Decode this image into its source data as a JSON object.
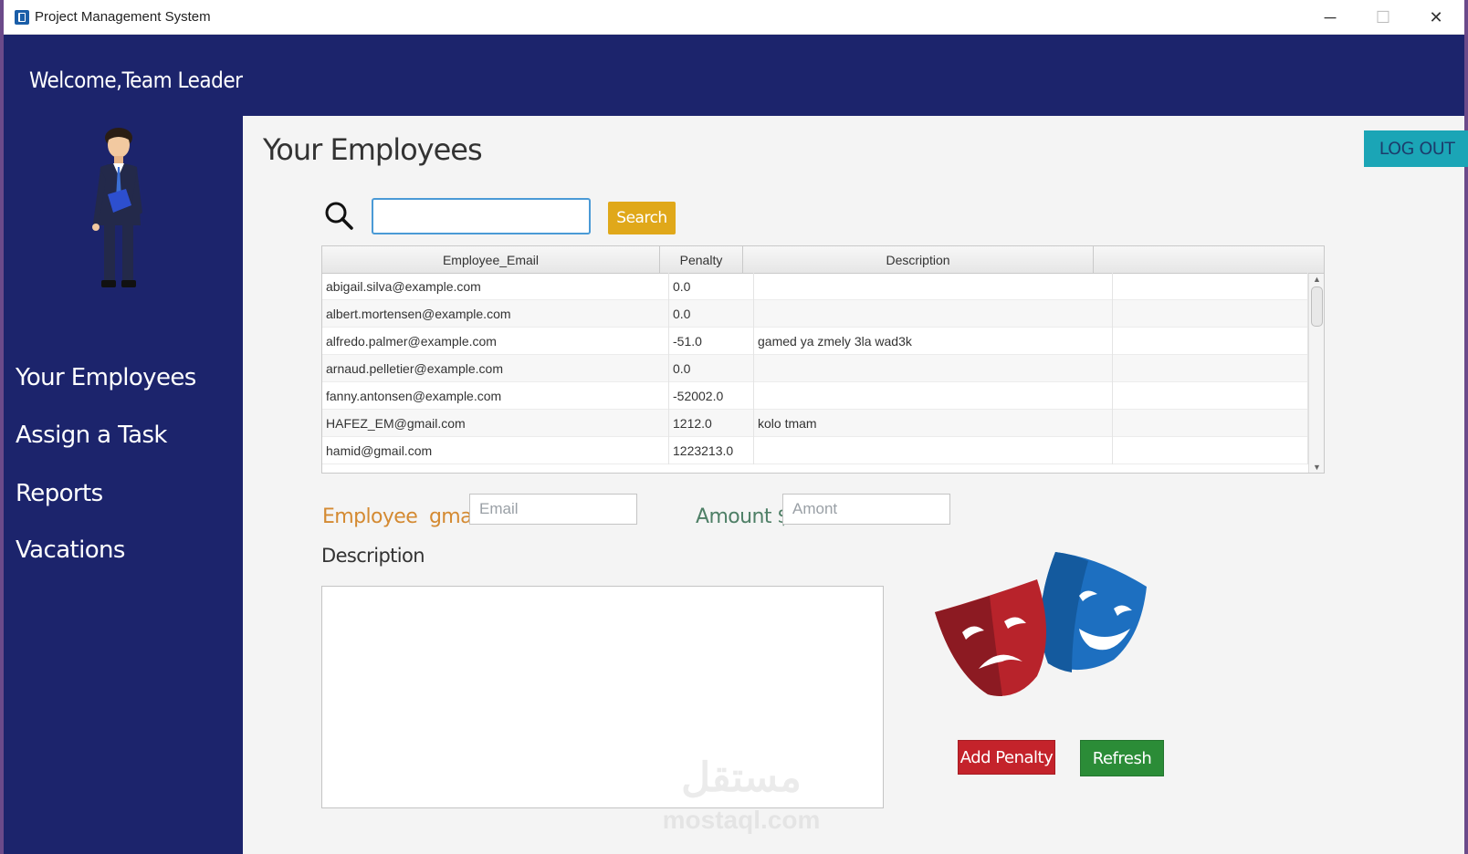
{
  "window": {
    "title": "Project Management System",
    "minimize": "─",
    "maximize": "☐",
    "close": "✕"
  },
  "header": {
    "welcome": "Welcome,Team Leader"
  },
  "sidebar": {
    "items": [
      {
        "label": "Your Employees"
      },
      {
        "label": "Assign a Task"
      },
      {
        "label": "Reports"
      },
      {
        "label": "Vacations"
      }
    ]
  },
  "main": {
    "title": "Your Employees",
    "logout_label": "LOG OUT",
    "search": {
      "value": "",
      "button_label": "Search"
    }
  },
  "table": {
    "columns": [
      "Employee_Email",
      "Penalty",
      "Description",
      ""
    ],
    "rows": [
      {
        "email": "abigail.silva@example.com",
        "penalty": "0.0",
        "description": ""
      },
      {
        "email": "albert.mortensen@example.com",
        "penalty": "0.0",
        "description": ""
      },
      {
        "email": "alfredo.palmer@example.com",
        "penalty": "-51.0",
        "description": "gamed ya zmely 3la wad3k"
      },
      {
        "email": "arnaud.pelletier@example.com",
        "penalty": "0.0",
        "description": ""
      },
      {
        "email": "fanny.antonsen@example.com",
        "penalty": "-52002.0",
        "description": ""
      },
      {
        "email": "HAFEZ_EM@gmail.com",
        "penalty": "1212.0",
        "description": "kolo tmam"
      },
      {
        "email": "hamid@gmail.com",
        "penalty": "1223213.0",
        "description": ""
      }
    ]
  },
  "form": {
    "email_label": "Employee  gmail",
    "email_placeholder": "Email",
    "amount_label": "Amount $",
    "amount_placeholder": "Amont",
    "description_label": "Description",
    "add_penalty_label": "Add Penalty",
    "refresh_label": "Refresh"
  },
  "watermark": {
    "arabic": "مستقل",
    "latin": "mostaql.com"
  },
  "colors": {
    "navy": "#1c246c",
    "logout": "#1ba5b6",
    "search_button": "#e0a81a",
    "add_penalty": "#c4232b",
    "refresh": "#2b8c37",
    "email_label": "#d48a32",
    "amount_label": "#4e7f66"
  }
}
